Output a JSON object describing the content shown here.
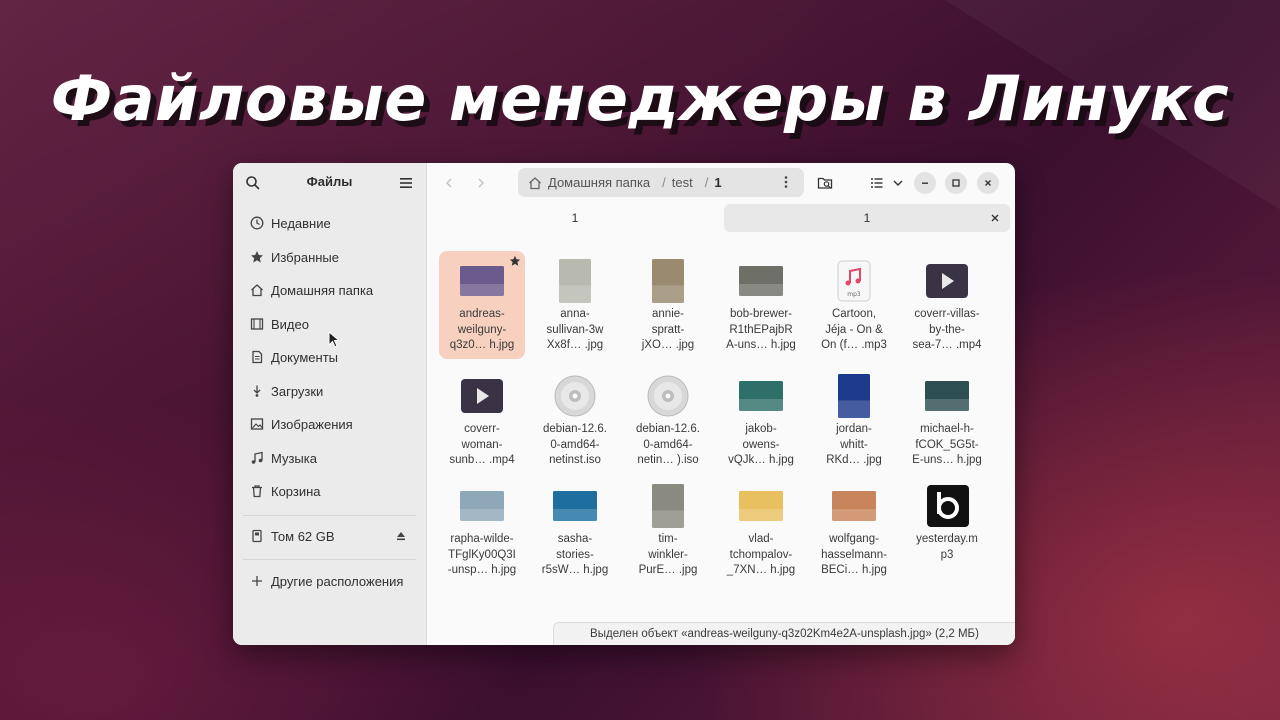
{
  "headline": "Файловые менеджеры в Линукс",
  "sidebar": {
    "title": "Файлы",
    "items": [
      {
        "label": "Недавние",
        "icon": "clock-icon"
      },
      {
        "label": "Избранные",
        "icon": "star-icon"
      },
      {
        "label": "Домашняя папка",
        "icon": "home-icon"
      },
      {
        "label": "Видео",
        "icon": "video-icon"
      },
      {
        "label": "Документы",
        "icon": "document-icon"
      },
      {
        "label": "Загрузки",
        "icon": "download-icon"
      },
      {
        "label": "Изображения",
        "icon": "image-icon"
      },
      {
        "label": "Музыка",
        "icon": "music-icon"
      },
      {
        "label": "Корзина",
        "icon": "trash-icon"
      }
    ],
    "volume": {
      "label": "Том 62 GB",
      "icon": "drive-icon"
    },
    "other": {
      "label": "Другие расположения",
      "icon": "plus-icon"
    }
  },
  "pathbar": {
    "home": "Домашняя папка",
    "seg1": "test",
    "seg2": "1"
  },
  "tabs": [
    {
      "label": "1"
    },
    {
      "label": "1"
    }
  ],
  "files": [
    {
      "name": "andreas-\nweilguny-\nq3z0… h.jpg",
      "kind": "image",
      "color": "#6b5a8c",
      "selected": true,
      "starred": true
    },
    {
      "name": "anna-\nsullivan-3w\nXx8f… .jpg",
      "kind": "image",
      "color": "#b8bab0"
    },
    {
      "name": "annie-\nspratt-\njXO… .jpg",
      "kind": "image",
      "color": "#9a8a70"
    },
    {
      "name": "bob-brewer-\nR1thEPajbR\nA-uns… h.jpg",
      "kind": "image",
      "color": "#6e7068"
    },
    {
      "name": "Cartoon,\nJéja - On &\nOn (f… .mp3",
      "kind": "audio",
      "color": "#e0486a"
    },
    {
      "name": "coverr-villas-\nby-the-\nsea-7… .mp4",
      "kind": "video",
      "color": "#3a3345"
    },
    {
      "name": "coverr-\nwoman-\nsunb… .mp4",
      "kind": "video",
      "color": "#3a3345"
    },
    {
      "name": "debian-12.6.\n0-amd64-\nnetinst.iso",
      "kind": "disc",
      "color": "#cfcfcf"
    },
    {
      "name": "debian-12.6.\n0-amd64-\nnetin… ).iso",
      "kind": "disc",
      "color": "#cfcfcf"
    },
    {
      "name": "jakob-\nowens-\nvQJk… h.jpg",
      "kind": "image",
      "color": "#2f6f6a"
    },
    {
      "name": "jordan-\nwhitt-\nRKd… .jpg",
      "kind": "image",
      "color": "#1d3a8c"
    },
    {
      "name": "michael-h-\nfCOK_5G5t-\nE-uns… h.jpg",
      "kind": "image",
      "color": "#2e4f52"
    },
    {
      "name": "rapha-wilde-\nTFglKy00Q3I\n-unsp… h.jpg",
      "kind": "image",
      "color": "#8fa8b8"
    },
    {
      "name": "sasha-\nstories-\nr5sW… h.jpg",
      "kind": "image",
      "color": "#1e6fa0"
    },
    {
      "name": "tim-\nwinkler-\nPurE… .jpg",
      "kind": "image",
      "color": "#8a8a80"
    },
    {
      "name": "vlad-\ntchompalov-\n_7XN… h.jpg",
      "kind": "image",
      "color": "#e8c060"
    },
    {
      "name": "wolfgang-\nhasselmann-\nBECi… h.jpg",
      "kind": "image",
      "color": "#c8845a"
    },
    {
      "name": "yesterday.m\np3",
      "kind": "app",
      "color": "#111111"
    }
  ],
  "status": "Выделен объект «andreas-weilguny-q3z02Km4e2A-unsplash.jpg» (2,2 МБ)"
}
